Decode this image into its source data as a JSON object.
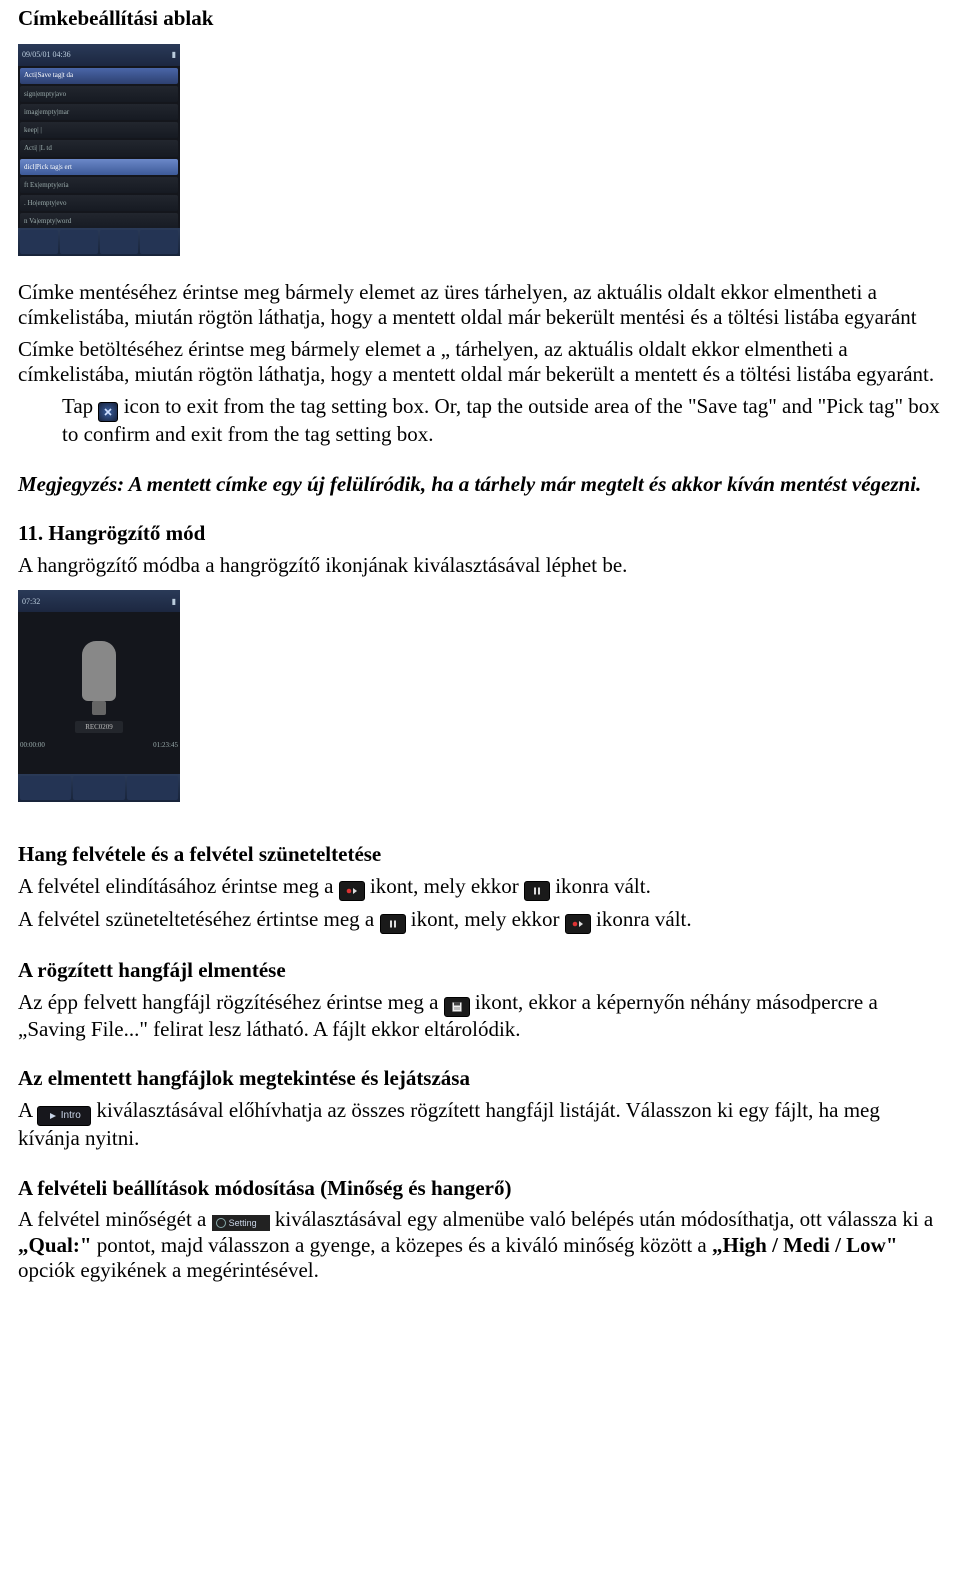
{
  "h_title": "Címkebeállítási ablak",
  "p1": "Címke mentéséhez érintse meg bármely elemet az üres tárhelyen, az aktuális oldalt ekkor elmentheti a címkelistába, miután rögtön láthatja, hogy a mentett oldal már bekerült mentési és a töltési listába egyaránt",
  "p2": "Címke betöltéséhez érintse meg bármely elemet a „ tárhelyen, az aktuális oldalt ekkor elmentheti a címkelistába, miután rögtön láthatja, hogy a mentett oldal már bekerült a mentett és a töltési listába egyaránt.",
  "tap_pre": "Tap",
  "tap_post": " icon to exit from the tag setting box. Or, tap the outside area of the \"Save tag\" and \"Pick tag\" box to confirm and exit from the tag setting box.",
  "note": "Megjegyzés: A mentett címke egy új felülíródik, ha a tárhely már megtelt és akkor kíván mentést végezni.",
  "h11": "11. Hangrögzítő mód",
  "p11": "A hangrögzítő módba a hangrögzítő ikonjának kiválasztásával léphet be.",
  "h_rec": "Hang felvétele és a felvétel szüneteltetése",
  "rec_line1_a": "A felvétel elindításához érintse meg a ",
  "rec_line1_b": " ikont, mely ekkor ",
  "rec_line1_c": " ikonra vált.",
  "rec_line2_a": "A felvétel szüneteltetéséhez értintse meg a ",
  "rec_line2_b": " ikont, mely ekkor ",
  "rec_line2_c": " ikonra vált.",
  "h_save": "A rögzített hangfájl elmentése",
  "save_a": "Az épp felvett hangfájl rögzítéséhez érintse meg a ",
  "save_b": " ikont, ekkor a képernyőn néhány másodpercre a „Saving File...\" felirat lesz látható. A fájlt ekkor eltárolódik.",
  "h_playback": "Az elmentett hangfájlok megtekintése és lejátszása",
  "playback_a": "A ",
  "playback_b": " kiválasztásával előhívhatja az összes rögzített hangfájl listáját. Válasszon ki egy fájlt, ha meg kívánja nyitni.",
  "h_settings": "A felvételi beállítások módosítása (Minőség és hangerő)",
  "settings_a": "A felvétel minőségét a ",
  "settings_b": " kiválasztásával egy almenübe való belépés után módosíthatja, ott válassza ki a ",
  "settings_qual": "„Qual:\"",
  "settings_c": " pontot, majd válasszon a gyenge, a közepes és a kiváló minőség között a ",
  "settings_hml": "„High / Medi / Low\"",
  "settings_d": " opciók egyikének a megérintésével.",
  "icons": {
    "intro_label": "Intro",
    "setting_label": "Setting"
  },
  "device1": {
    "time": "09/05/01   04:36",
    "rows": [
      "Acti|Save tag|t da",
      "sign|empty|avo",
      "imag|empty|mar",
      "keep| | ",
      "Acti| |L td",
      "dicl|Pick tag|s ert",
      "ft Ex|empty|eria",
      ". Ho|empty|evo",
      "n Va|empty|word"
    ]
  },
  "device2": {
    "time": "07:32",
    "label": "REC0209",
    "left_time": "00:00:00",
    "right_time": "01:23:45"
  }
}
